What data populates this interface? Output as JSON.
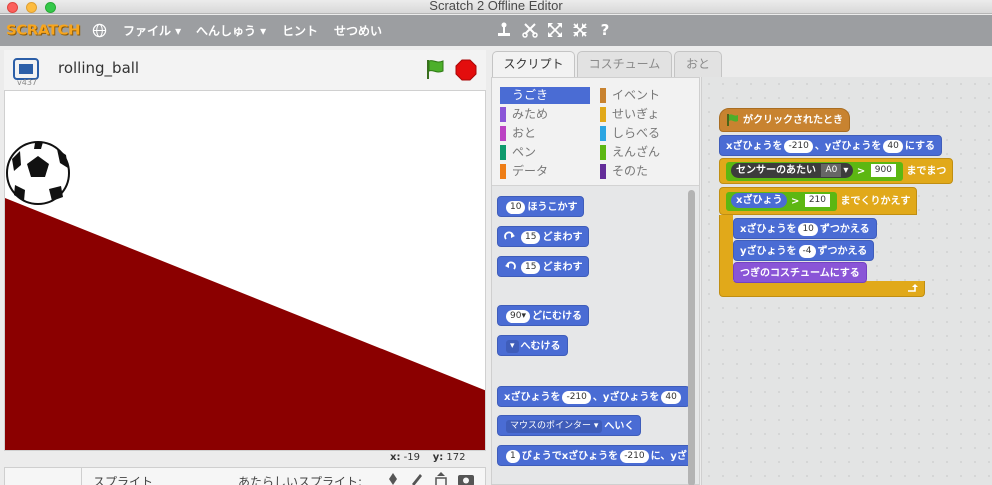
{
  "window": {
    "title": "Scratch 2 Offline Editor"
  },
  "menubar": {
    "logo": "SCRATCH",
    "items": [
      "ファイル ▾",
      "へんしゅう ▾",
      "ヒント",
      "せつめい"
    ]
  },
  "stage": {
    "version": "v437",
    "project_title": "rolling_ball",
    "mouse_x_label": "x:",
    "mouse_x": "-19",
    "mouse_y_label": "y:",
    "mouse_y": "172",
    "slope_color": "#8b0000"
  },
  "sprites": {
    "label": "スプライト",
    "new_sprite_label": "あたらしいスプライト:"
  },
  "tabs": [
    "スクリプト",
    "コスチューム",
    "おと"
  ],
  "categories": [
    {
      "label": "うごき",
      "color": "#4a6cd4",
      "selected": true
    },
    {
      "label": "みため",
      "color": "#8a55d7"
    },
    {
      "label": "おと",
      "color": "#bb42c3"
    },
    {
      "label": "ペン",
      "color": "#0e9a6c"
    },
    {
      "label": "データ",
      "color": "#ee7d16"
    },
    {
      "label": "イベント",
      "color": "#c88330"
    },
    {
      "label": "せいぎょ",
      "color": "#e1a91a"
    },
    {
      "label": "しらべる",
      "color": "#2ca5e2"
    },
    {
      "label": "えんざん",
      "color": "#5cb712"
    },
    {
      "label": "そのた",
      "color": "#632d99"
    }
  ],
  "palette": {
    "move_steps": "10",
    "move_label": "ほうこかす",
    "turn_cw_deg": "15",
    "turn_cw_label": "どまわす",
    "turn_ccw_deg": "15",
    "turn_ccw_label": "どまわす",
    "point_dir": "90▾",
    "point_dir_label": "どにむける",
    "point_towards_label": "へむける",
    "goto_x_prefix": "xざひょうを",
    "goto_x": "-210",
    "goto_y_prefix": "、yざひょうを",
    "goto_y": "40",
    "goto_target": "マウスのポインター",
    "goto_target_suffix": "へいく",
    "glide_secs": "1",
    "glide_prefix": "びょうでxざひょうを",
    "glide_x": "-210",
    "glide_y_prefix": "に、yざ"
  },
  "script": {
    "hat_label": "がクリックされたとき",
    "set_x_prefix": "xざひょうを",
    "set_x": "-210",
    "set_y_prefix": "、yざひょうを",
    "set_y": "40",
    "set_suffix": "にする",
    "sensor_label": "センサーのあたい",
    "sensor_port": "A0",
    "gt_symbol": ">",
    "sensor_threshold": "900",
    "wait_until_suffix": "までまつ",
    "x_pos_label": "xざひょう",
    "x_gt": ">",
    "x_limit": "210",
    "repeat_until_suffix": "までくりかえす",
    "change_x_prefix": "xざひょうを",
    "change_x": "10",
    "change_x_suffix": "ずつかえる",
    "change_y_prefix": "yざひょうを",
    "change_y": "-4",
    "change_y_suffix": "ずつかえる",
    "next_costume": "つぎのコスチュームにする"
  }
}
